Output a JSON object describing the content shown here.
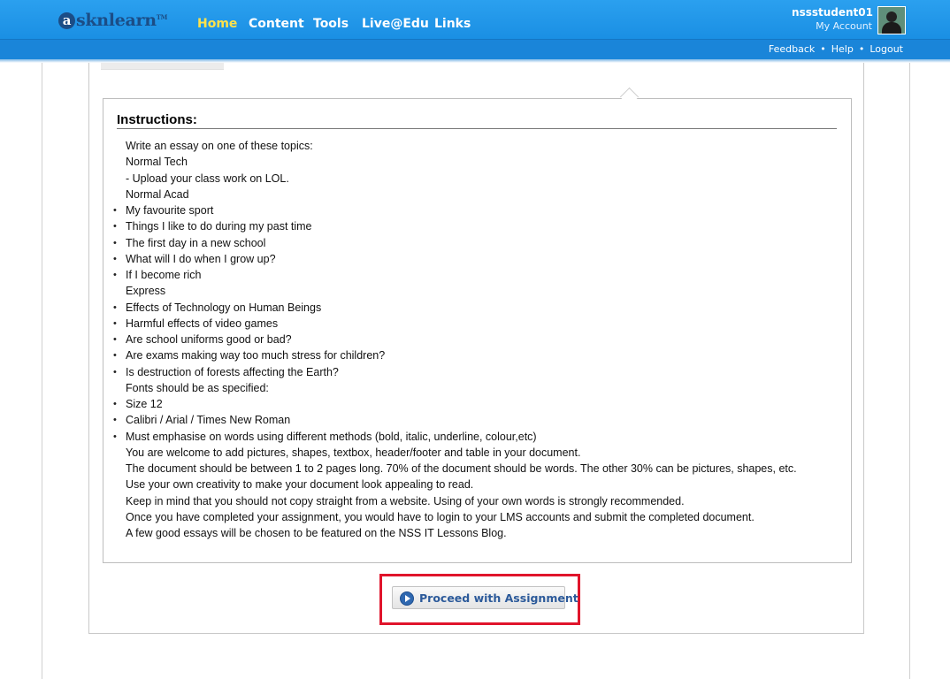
{
  "header": {
    "logo_text": "asknlearn",
    "logo_letter": "a",
    "logo_rest": "sknlearn",
    "logo_tm": "TM",
    "nav": [
      "Home",
      "Content",
      "Tools",
      "Live@Edu",
      "Links"
    ],
    "active_nav": "Home",
    "username": "nssstudent01",
    "my_account": "My Account",
    "links": [
      "Feedback",
      "Help",
      "Logout"
    ],
    "link_separator": "•"
  },
  "instructions": {
    "title": "Instructions:",
    "lines": [
      {
        "text": "Write an essay on one of these topics:",
        "bullet": false
      },
      {
        "text": "Normal Tech",
        "bullet": false
      },
      {
        "text": "- Upload your class work on LOL.",
        "bullet": false
      },
      {
        "text": "Normal Acad",
        "bullet": false
      },
      {
        "text": "My favourite sport",
        "bullet": true
      },
      {
        "text": "Things I like to do during my past time",
        "bullet": true
      },
      {
        "text": "The first day in a new school",
        "bullet": true
      },
      {
        "text": "What will I do when I grow up?",
        "bullet": true
      },
      {
        "text": "If I become rich",
        "bullet": true
      },
      {
        "text": "Express",
        "bullet": false
      },
      {
        "text": "Effects of Technology on Human Beings",
        "bullet": true
      },
      {
        "text": "Harmful effects of video games",
        "bullet": true
      },
      {
        "text": "Are school uniforms good or bad?",
        "bullet": true
      },
      {
        "text": "Are exams making way too much stress for children?",
        "bullet": true
      },
      {
        "text": "Is destruction of forests affecting the Earth?",
        "bullet": true
      },
      {
        "text": "Fonts should be as specified:",
        "bullet": false
      },
      {
        "text": "Size 12",
        "bullet": true
      },
      {
        "text": "Calibri / Arial / Times New Roman",
        "bullet": true
      },
      {
        "text": "Must emphasise on words using different methods (bold, italic, underline, colour,etc)",
        "bullet": true
      },
      {
        "text": "You are welcome to add pictures, shapes, textbox, header/footer and table in your document.",
        "bullet": false
      },
      {
        "text": "The document should be between 1 to 2 pages long. 70% of the document should be words. The other 30% can be pictures, shapes, etc.",
        "bullet": false
      },
      {
        "text": "Use your own creativity to make your document look appealing to read.",
        "bullet": false
      },
      {
        "text": "Keep in mind that you should not copy straight from a website. Using of your own words is strongly recommended.",
        "bullet": false
      },
      {
        "text": "Once you have completed your assignment, you would have to login to your LMS accounts and submit the completed document.",
        "bullet": false
      },
      {
        "text": "A few good essays will be chosen to be featured on the NSS IT Lessons Blog.",
        "bullet": false
      }
    ]
  },
  "actions": {
    "proceed_label": "Proceed with Assignment",
    "proceed_icon": "play-circle-icon"
  },
  "colors": {
    "header_blue": "#1a8fe3",
    "active_nav": "#ffe24a",
    "highlight_red": "#e0142b",
    "button_text": "#2c5a9a"
  }
}
